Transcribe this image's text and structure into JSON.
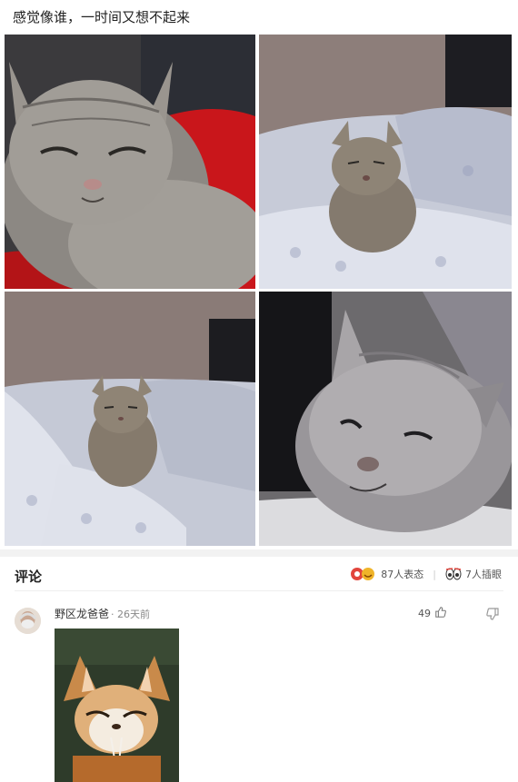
{
  "post": {
    "text": "感觉像谁，一时间又想不起来"
  },
  "comments": {
    "title": "评论",
    "reactions_count": "87人表态",
    "collections_count": "7人插眼"
  },
  "comment": {
    "username": "野区龙爸爸",
    "timestamp": "· 26天前",
    "likes": "49"
  },
  "colors": {
    "text_primary": "#222222",
    "text_secondary": "#888888",
    "separator": "#f2f2f2"
  },
  "icons": {
    "like": "thumbs-up-icon",
    "reply": "reply-icon",
    "reactions": "emoji-reactions-icon",
    "eyes": "eyes-icon"
  }
}
